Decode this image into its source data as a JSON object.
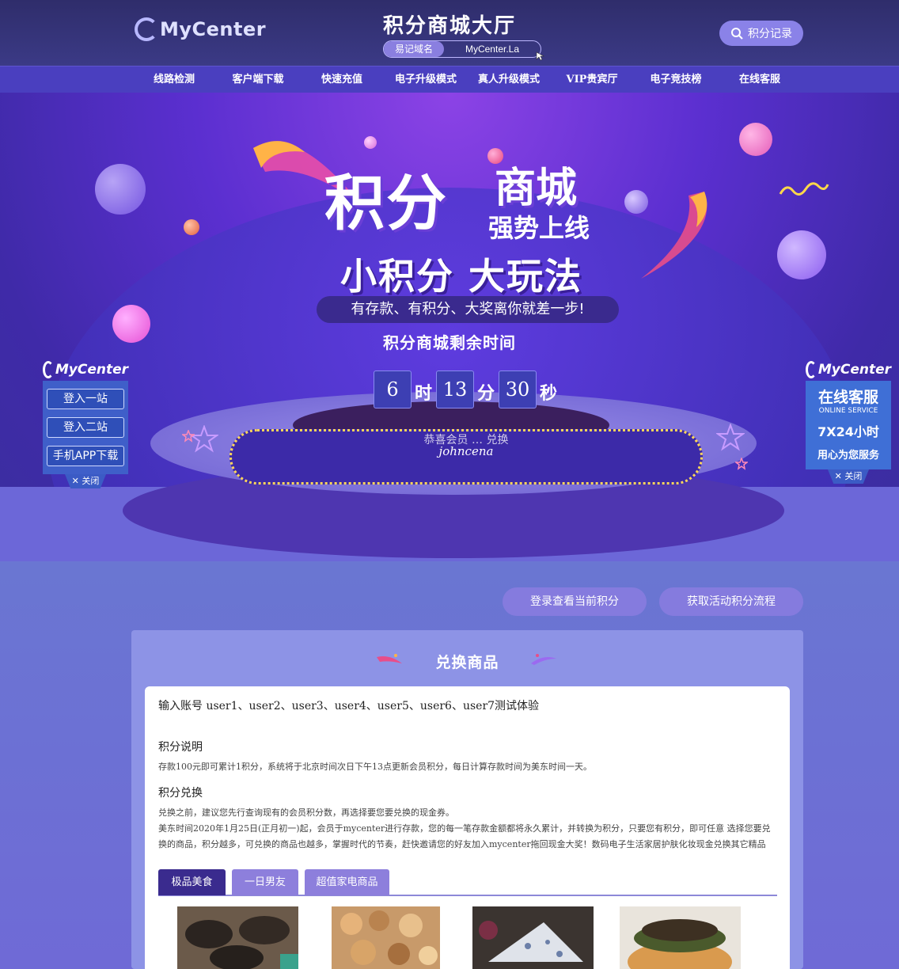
{
  "header": {
    "logo_text": "MyCenter",
    "title": "积分商城大厅",
    "domain_label": "易记域名",
    "domain_value": "MyCenter.La",
    "record_button": "积分记录"
  },
  "nav": {
    "items": [
      {
        "label": "线路检测"
      },
      {
        "label": "客户端下载"
      },
      {
        "label": "快速充值"
      },
      {
        "label": "电子升级模式"
      },
      {
        "label": "真人升级模式"
      },
      {
        "label": "VIP贵宾厅"
      },
      {
        "label": "电子竞技榜"
      },
      {
        "label": "在线客服"
      }
    ]
  },
  "banner": {
    "headline_main": "积分",
    "headline_side": "商城",
    "headline_sub": "强势上线",
    "slogan": "小积分  大玩法",
    "subtitle": "有存款、有积分、大奖离你就差一步!",
    "countdown_label": "积分商城剩余时间",
    "countdown": {
      "hours": "6",
      "hours_unit": "时",
      "minutes": "13",
      "minutes_unit": "分",
      "seconds": "30",
      "seconds_unit": "秒"
    },
    "marquee_ghost": "恭喜会员 …   兑换",
    "marquee_user": "johncena"
  },
  "left_float": {
    "logo_text": "MyCenter",
    "buttons": [
      {
        "label": "登入一站"
      },
      {
        "label": "登入二站"
      },
      {
        "label": "手机APP下载"
      }
    ],
    "close": "关闭"
  },
  "right_float": {
    "logo_text": "MyCenter",
    "title": "在线客服",
    "subtitle": "ONLINE SERVICE",
    "hours": "7X24小时",
    "tagline": "用心为您服务",
    "close": "关闭"
  },
  "actions": {
    "check_points": "登录查看当前积分",
    "points_flow": "获取活动积分流程"
  },
  "exchange": {
    "title": "兑换商品",
    "hint": "输入账号 user1、user2、user3、user4、user5、user6、user7测试体验",
    "points_heading": "积分说明",
    "points_text": "存款100元即可累计1积分，系统将于北京时间次日下午13点更新会员积分，每日计算存款时间为美东时间一天。",
    "redeem_heading": "积分兑换",
    "redeem_text_1": "兑换之前，建议您先行查询现有的会员积分数，再选择要您要兑换的现金券。",
    "redeem_text_2": "美东时间2020年1月25日(正月初一)起，会员于mycenter进行存款，您的每一笔存款金额都将永久累计，并转换为积分，只要您有积分，即可任意 选择您要兑换的商品，积分越多，可兑换的商品也越多，掌握时代的节奏，赶快邀请您的好友加入mycenter拖回现金大奖！数码电子生活家居护肤化妆现金兑换其它精品",
    "tabs": [
      {
        "label": "极品美食"
      },
      {
        "label": "一日男友"
      },
      {
        "label": "超值家电商品"
      }
    ],
    "products": [
      {
        "image": "dark-cookies"
      },
      {
        "image": "assorted-cookies"
      },
      {
        "image": "blue-cheese"
      },
      {
        "image": "burger"
      }
    ]
  },
  "colors": {
    "nav_bg": "#4a3fbf",
    "active_tab": "#3a2b8e",
    "panel_bg": "#8d93e6",
    "countdown_box": "#3d3fb3"
  }
}
